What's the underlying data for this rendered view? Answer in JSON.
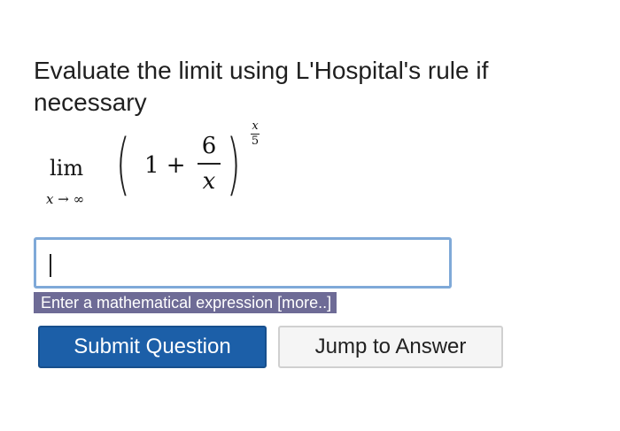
{
  "question": {
    "text": "Evaluate the limit using L'Hospital's rule if necessary"
  },
  "expression": {
    "lim_word": "lim",
    "lim_var": "x",
    "lim_arrow": " → ",
    "lim_target": "∞",
    "left_paren": "(",
    "one_plus": "1 +",
    "frac_num": "6",
    "frac_den": "x",
    "right_paren": ")",
    "exp_num": "x",
    "exp_den": "5"
  },
  "answer": {
    "value": "",
    "hint": "Enter a mathematical expression",
    "more_link": "[more..]"
  },
  "buttons": {
    "submit": "Submit Question",
    "jump": "Jump to Answer"
  }
}
